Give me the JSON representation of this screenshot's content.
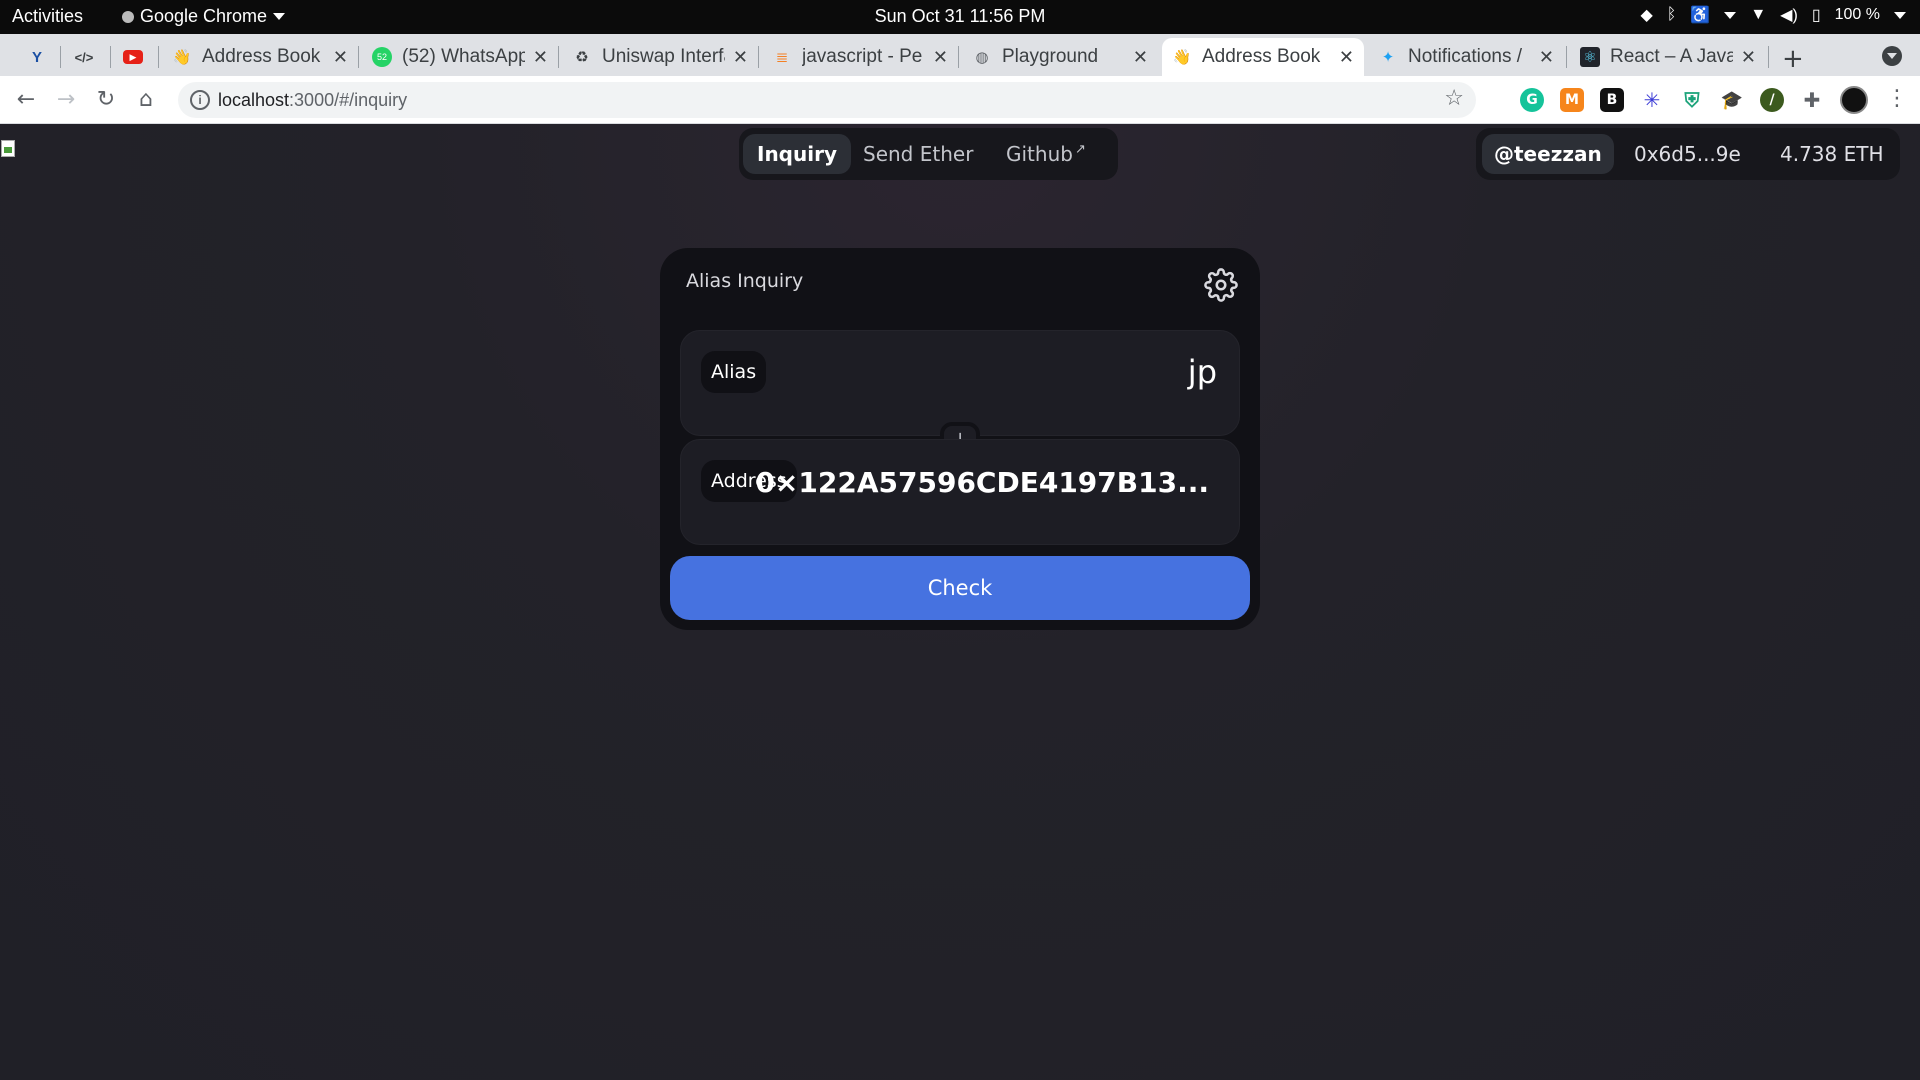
{
  "system_bar": {
    "activities": "Activities",
    "app_name": "Google Chrome",
    "datetime": "Sun Oct 31  11:56 PM",
    "battery": "100 %"
  },
  "tabs": [
    {
      "title": "Address Book",
      "favicon": "waving-hand-icon"
    },
    {
      "title": "(52) WhatsApp",
      "favicon": "whatsapp-icon",
      "badge": "52"
    },
    {
      "title": "Uniswap Interface",
      "favicon": "uniswap-icon"
    },
    {
      "title": "javascript - Pe",
      "favicon": "stackoverflow-icon"
    },
    {
      "title": "Playground",
      "favicon": "globe-icon"
    },
    {
      "title": "Address Book",
      "favicon": "waving-hand-icon",
      "active": true
    },
    {
      "title": "Notifications /",
      "favicon": "twitter-icon"
    },
    {
      "title": "React – A Java",
      "favicon": "react-icon"
    }
  ],
  "browser": {
    "url_host": "localhost",
    "url_rest": ":3000/#/inquiry",
    "extensions": [
      "grammarly-icon",
      "metamask-icon",
      "extension-b-icon",
      "perplexity-icon",
      "shield-icon",
      "hat-icon",
      "circle-slash-icon",
      "puzzle-icon"
    ]
  },
  "app": {
    "nav": {
      "inquiry": "Inquiry",
      "send": "Send Ether",
      "github": "Github"
    },
    "account": {
      "handle": "@teezzan",
      "address": "0x6d5...9e",
      "balance": "4.738 ETH"
    },
    "card": {
      "title": "Alias Inquiry",
      "alias_label": "Alias",
      "alias_value": "jp",
      "address_label": "Address",
      "address_value": "0×122A57596CDE4197B13...",
      "button": "Check"
    }
  },
  "colors": {
    "accent": "#4672e0",
    "card_bg": "#111116",
    "page_bg": "#202027"
  }
}
